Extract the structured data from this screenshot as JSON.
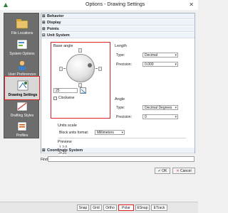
{
  "window": {
    "title": "Options - Drawing Settings"
  },
  "nav": [
    {
      "label": "File Locations"
    },
    {
      "label": "System Options"
    },
    {
      "label": "User Preferences"
    },
    {
      "label": "Drawing Settings",
      "active": true
    },
    {
      "label": "Drafting Styles"
    },
    {
      "label": "Profiles"
    }
  ],
  "tree": {
    "behavior": "Behavior",
    "display": "Display",
    "points": "Points",
    "unit_system": "Unit System",
    "coordinate_system": "Coordinate System"
  },
  "base_angle": {
    "title": "Base angle",
    "value": "25",
    "clockwise_label": "Clockwise",
    "clockwise_checked": false
  },
  "length": {
    "title": "Length",
    "type_label": "Type:",
    "type_value": "Decimal",
    "precision_label": "Precision:",
    "precision_value": "0.000"
  },
  "angle": {
    "title": "Angle",
    "type_label": "Type:",
    "type_value": "Decimal Degrees",
    "precision_label": "Precision:",
    "precision_value": "0"
  },
  "units_scale": {
    "title": "Units scale",
    "block_label": "Block units format:",
    "block_value": "Millimeters"
  },
  "preview": {
    "title": "Preview",
    "line1": "1,2,0",
    "line2": "3<20"
  },
  "find": {
    "label": "Find:",
    "value": ""
  },
  "buttons": {
    "ok": "OK",
    "cancel": "Cancel"
  },
  "status_bar": [
    "Snap",
    "Grid",
    "Ortho",
    "Polar",
    "ESnap",
    "ETrack"
  ],
  "status_active": "Polar"
}
